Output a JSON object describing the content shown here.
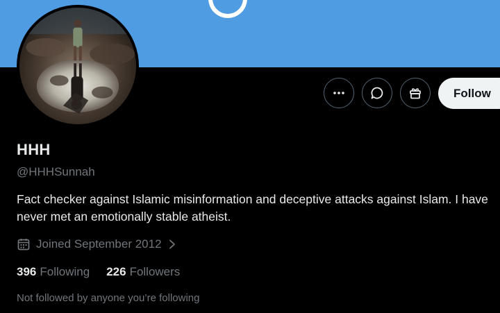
{
  "profile": {
    "display_name": "HHH",
    "handle": "@HHHSunnah",
    "bio": "Fact checker against Islamic misinformation and deceptive attacks against Islam. I have never met an emotionally stable atheist.",
    "joined": "Joined September 2012",
    "following_count": "396",
    "following_label": "Following",
    "followers_count": "226",
    "followers_label": "Followers",
    "followed_by_note": "Not followed by anyone you’re following"
  },
  "actions": {
    "more_icon": "more-horizontal-icon",
    "message_icon": "message-icon",
    "gift_icon": "gift-icon",
    "follow_label": "Follow"
  },
  "colors": {
    "banner": "#4f9ce2",
    "background": "#000000",
    "primary_text": "#e7e9ea",
    "secondary_text": "#71767b",
    "follow_button": "#eff3f4"
  }
}
